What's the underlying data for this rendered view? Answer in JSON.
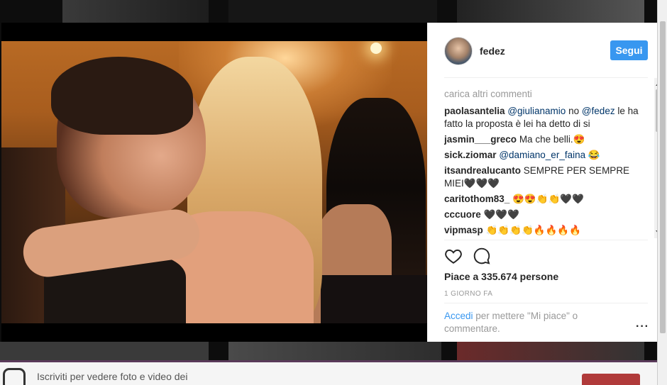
{
  "post": {
    "username": "fedez",
    "follow_label": "Segui",
    "load_more": "carica altri commenti",
    "comments": [
      {
        "user": "paolasantelia",
        "mention1": "@giulianamio",
        "mid": " no ",
        "mention2": "@fedez",
        "text": " le ha fatto la proposta è lei ha detto di si"
      },
      {
        "user": "jasmin___greco",
        "text": " Ma che belli.😍"
      },
      {
        "user": "sick.ziomar",
        "mention1": "@damiano_er_faina",
        "text": " 😂"
      },
      {
        "user": "itsandrealucanto",
        "text": " SEMPRE PER SEMPRE MIEI🖤🖤🖤"
      },
      {
        "user": "caritothom83_",
        "text": " 😍😍👏👏🖤🖤"
      },
      {
        "user": "cccuore",
        "text": " 🖤🖤🖤"
      },
      {
        "user": "vipmasp",
        "text": " 👏👏👏👏🔥🔥🔥🔥"
      }
    ],
    "likes_text": "Piace a 335.674 persone",
    "time_ago": "1 GIORNO FA",
    "login_link": "Accedi",
    "login_text": " per mettere \"Mi piace\" o commentare.",
    "more_icon": "···"
  },
  "banner": {
    "text": "Iscriviti per vedere foto e video dei"
  },
  "colors": {
    "accent": "#3897f0",
    "text": "#262626",
    "muted": "#999999",
    "mention": "#003569"
  }
}
